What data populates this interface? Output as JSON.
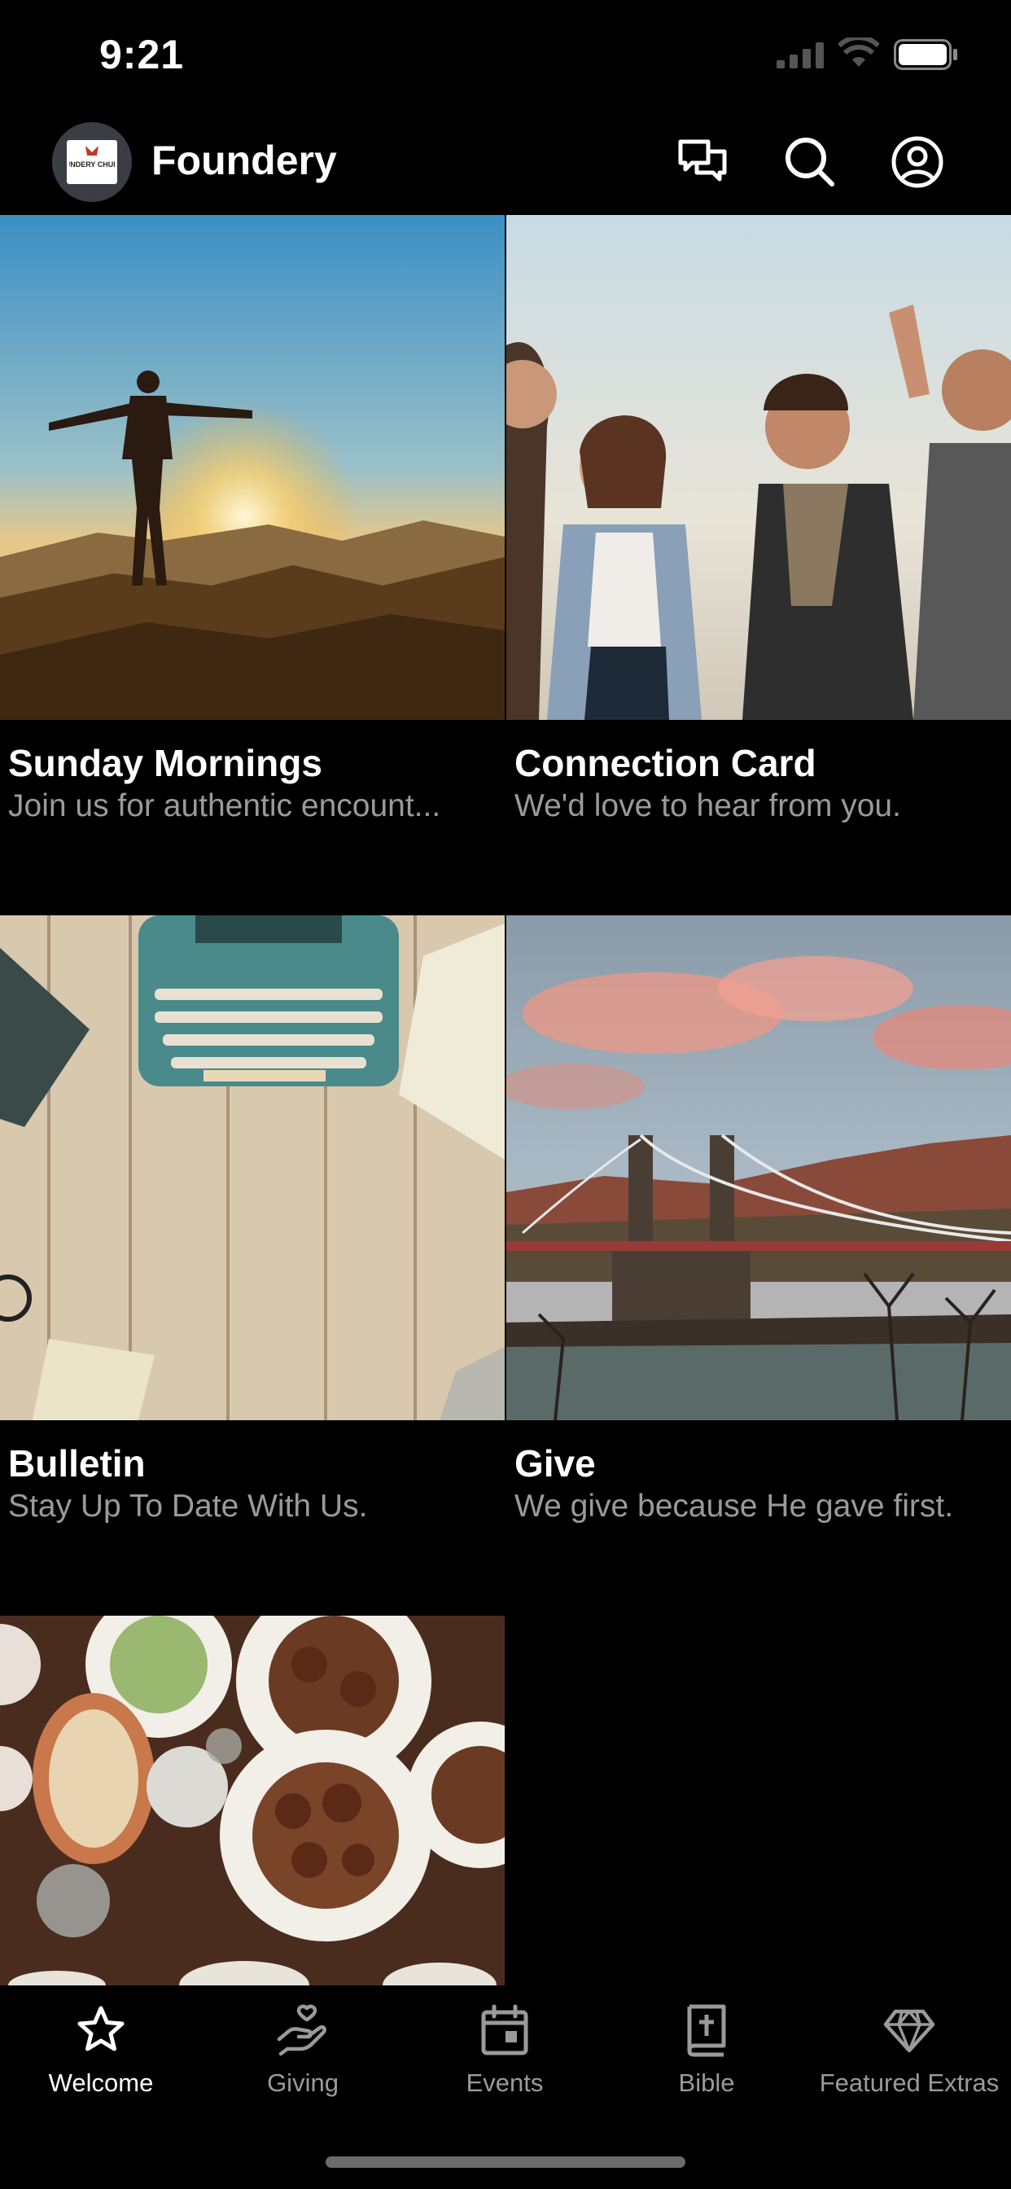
{
  "status_bar": {
    "time": "9:21",
    "icons": [
      "signal-icon",
      "wifi-icon",
      "battery-icon"
    ]
  },
  "header": {
    "title": "Foundery",
    "logo_text": "FOUNDERY CHURCH",
    "icons": [
      "chat-icon",
      "search-icon",
      "account-icon"
    ]
  },
  "cards": [
    {
      "title": "Sunday Mornings",
      "subtitle": "Join us for authentic encount...",
      "image": "sunrise-mountain-photo"
    },
    {
      "title": "Connection Card",
      "subtitle": "We'd love to hear from you.",
      "image": "friends-laughing-photo"
    },
    {
      "title": "Bulletin",
      "subtitle": "Stay Up To Date With Us.",
      "image": "typewriter-desk-photo"
    },
    {
      "title": "Give",
      "subtitle": "We give because He gave first.",
      "image": "suspension-bridge-photo"
    },
    {
      "title": "",
      "subtitle": "",
      "image": "food-table-photo"
    }
  ],
  "tabs": [
    {
      "label": "Welcome",
      "icon": "star-icon",
      "active": true
    },
    {
      "label": "Giving",
      "icon": "giving-hand-icon",
      "active": false
    },
    {
      "label": "Events",
      "icon": "calendar-icon",
      "active": false
    },
    {
      "label": "Bible",
      "icon": "bible-icon",
      "active": false
    },
    {
      "label": "Featured Extras",
      "icon": "diamond-icon",
      "active": false
    }
  ],
  "colors": {
    "background": "#000000",
    "text_primary": "#ffffff",
    "text_secondary": "#9a9a9a",
    "tab_inactive": "#9a9a9a"
  }
}
